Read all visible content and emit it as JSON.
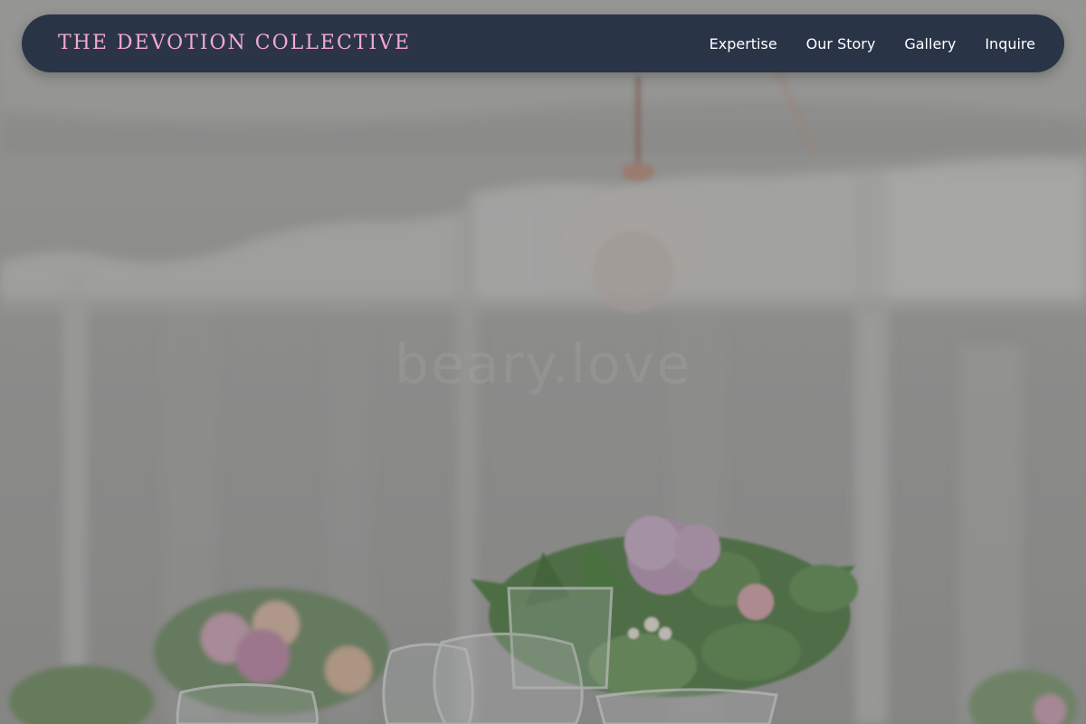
{
  "nav": {
    "brand": "THE DEVOTION COLLECTIVE",
    "links": [
      {
        "label": "Expertise"
      },
      {
        "label": "Our Story"
      },
      {
        "label": "Gallery"
      },
      {
        "label": "Inquire"
      }
    ]
  },
  "hero": {
    "watermark": "beary.love",
    "image": "wedding-reception-table-with-flowers-and-glasses"
  },
  "colors": {
    "nav_background": "#212d42",
    "brand_text": "#f2a9cf",
    "nav_text": "#ffffff"
  }
}
